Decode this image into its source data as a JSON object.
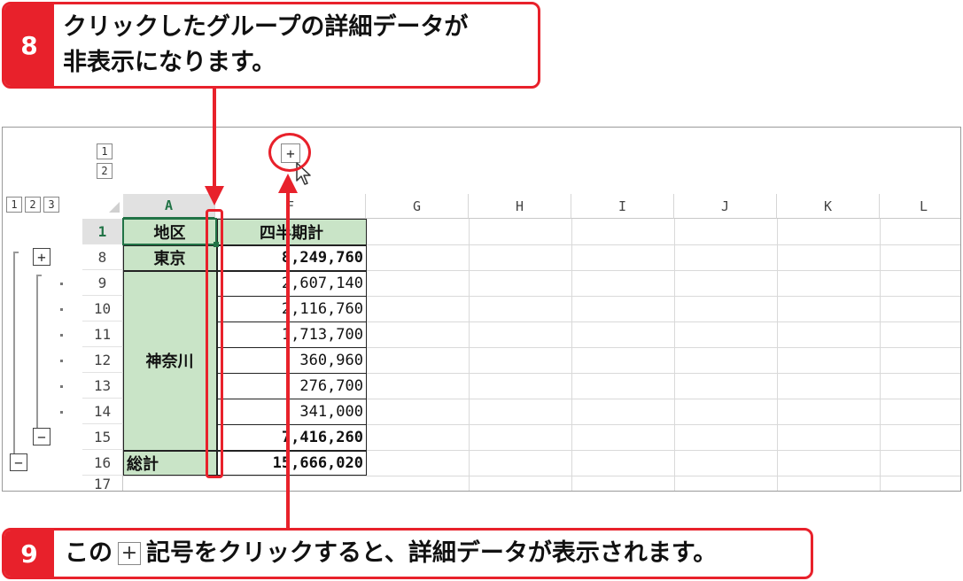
{
  "callout8": {
    "number": "8",
    "line1": "クリックしたグループの詳細データが",
    "line2": "非表示になります。"
  },
  "callout9": {
    "number": "9",
    "text_before": "この",
    "icon": "plus-box-icon",
    "icon_glyph": "+",
    "text_after": "記号をクリックすると、詳細データが表示されます。"
  },
  "sheet": {
    "column_outline_levels": [
      "1",
      "2"
    ],
    "column_expand_button": "+",
    "row_outline_levels": [
      "1",
      "2",
      "3"
    ],
    "columns": [
      "A",
      "F",
      "G",
      "H",
      "I",
      "J",
      "K",
      "L"
    ],
    "row_numbers": [
      "1",
      "8",
      "9",
      "10",
      "11",
      "12",
      "13",
      "14",
      "15",
      "16",
      "17"
    ],
    "row_outline_buttons": {
      "level2_expand": "+",
      "level3_collapse": "−",
      "level2_collapse": "−"
    },
    "table": {
      "header_region": "地区",
      "header_total": "四半期計",
      "tokyo_label": "東京",
      "tokyo_value": "8,249,760",
      "kanagawa_label": "神奈川",
      "kanagawa_values": [
        "2,607,140",
        "2,116,760",
        "1,713,700",
        "360,960",
        "276,700",
        "341,000"
      ],
      "kanagawa_total": "7,416,260",
      "grand_label": "総計",
      "grand_value": "15,666,020"
    }
  },
  "colors": {
    "accent_red": "#e8212b",
    "table_green": "#c9e4c7",
    "selection_green": "#217346"
  }
}
